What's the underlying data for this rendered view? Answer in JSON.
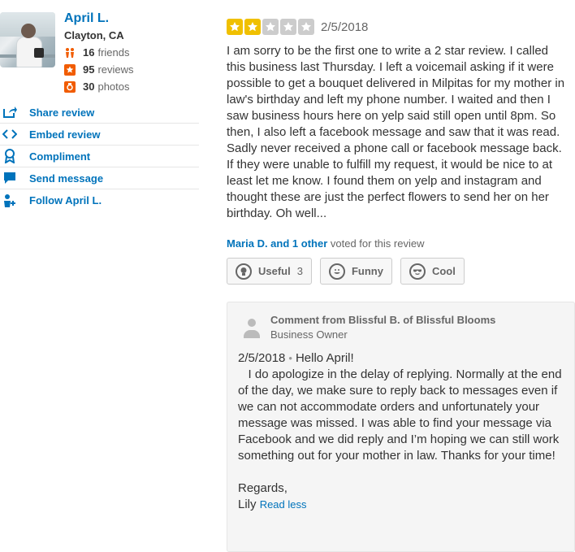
{
  "user": {
    "name": "April L.",
    "location": "Clayton, CA",
    "friends_count": "16",
    "friends_label": "friends",
    "reviews_count": "95",
    "reviews_label": "reviews",
    "photos_count": "30",
    "photos_label": "photos"
  },
  "actions": [
    {
      "label": "Share review",
      "icon": "share-icon"
    },
    {
      "label": "Embed review",
      "icon": "embed-icon"
    },
    {
      "label": "Compliment",
      "icon": "compliment-icon"
    },
    {
      "label": "Send message",
      "icon": "message-icon"
    },
    {
      "label": "Follow April L.",
      "icon": "follow-icon"
    }
  ],
  "review": {
    "rating": 2,
    "max_rating": 5,
    "date": "2/5/2018",
    "text": "I am sorry to be the first one to write a 2 star review.  I called this business last Thursday. I left a voicemail asking if it were possible to get a bouquet delivered in Milpitas for my mother in law's birthday and left my phone number. I waited and then I saw business hours here on yelp said still open until 8pm. So then, I also left a facebook message and saw that it was read. Sadly never received a phone call or facebook message back. If they were unable to fulfill my request, it would be nice to at least let me know. I found them on yelp and instagram and thought these are just the perfect flowers to send her on her birthday. Oh well..."
  },
  "votes": {
    "voters_link": "Maria D. and 1 other",
    "voters_suffix": "voted for this review",
    "useful_label": "Useful",
    "useful_count": "3",
    "funny_label": "Funny",
    "cool_label": "Cool"
  },
  "comment": {
    "from": "Comment from Blissful B. of Blissful Blooms",
    "role": "Business Owner",
    "date": "2/5/2018",
    "separator": "•",
    "greeting": "Hello April!",
    "body": "   I do apologize in the delay of replying. Normally at the end of the day, we make sure to reply back to messages even if we can not accommodate orders and unfortunately your message was missed. I was able to find your message via Facebook and we did reply and I’m hoping we can still work something out for your mother in law. Thanks for your time!",
    "regards": "Regards,",
    "signature": "Lily",
    "read_less": "Read less"
  },
  "colors": {
    "link": "#0073bb",
    "star_on": "#f0c000",
    "star_off": "#cccccc",
    "stat_icon": "#f15c00"
  }
}
